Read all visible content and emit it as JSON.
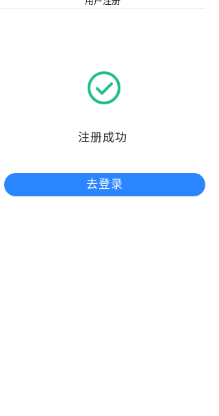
{
  "header": {
    "title": "用户注册"
  },
  "result": {
    "icon": "check-circle-icon",
    "message": "注册成功",
    "accent_color": "#1dbf8f"
  },
  "actions": {
    "login_label": "去登录",
    "button_color": "#2a85ff"
  }
}
